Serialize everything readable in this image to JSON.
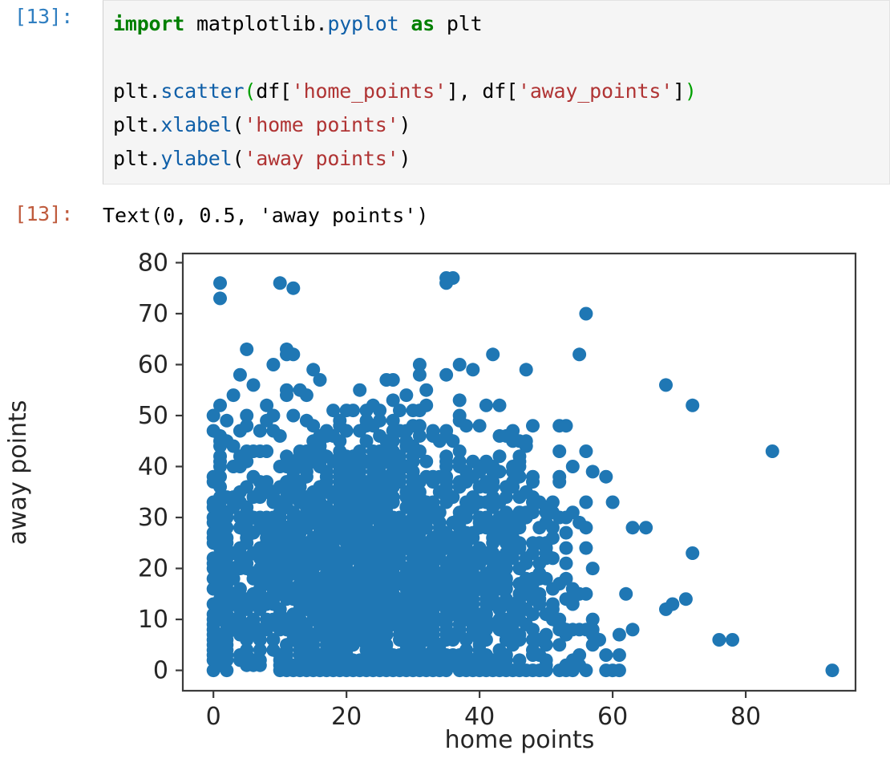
{
  "cell": {
    "input_prompt": "[13]:",
    "output_prompt": "[13]:",
    "code_lines": [
      "import matplotlib.pyplot as plt",
      "",
      "plt.scatter(df['home_points'], df['away_points'])",
      "plt.xlabel('home points')",
      "plt.ylabel('away points')"
    ],
    "code_tokens": {
      "l1_kw": "import",
      "l1_sp1": " ",
      "l1_mod_a": "matplotlib.",
      "l1_mod_b": "pyplot",
      "l1_sp2": " ",
      "l1_as": "as",
      "l1_sp3": " ",
      "l1_plt": "plt",
      "l3_plt": "plt.",
      "l3_fn": "scatter",
      "l3_open": "(",
      "l3_df1": "df[",
      "l3_s1": "'home_points'",
      "l3_mid": "], df[",
      "l3_s2": "'away_points'",
      "l3_close1": "]",
      "l3_close2": ")",
      "l4_plt": "plt.",
      "l4_fn": "xlabel",
      "l4_open": "(",
      "l4_s": "'home points'",
      "l4_close": ")",
      "l5_plt": "plt.",
      "l5_fn": "ylabel",
      "l5_open": "(",
      "l5_s": "'away points'",
      "l5_close": ")"
    },
    "output_text": "Text(0, 0.5, 'away points')"
  },
  "colors": {
    "input_prompt": "#307fc1",
    "output_prompt": "#bf5b3d",
    "cell_background": "#f5f5f5",
    "cell_border": "#e3e3e3",
    "marker": "#1f77b4",
    "axis": "#3b3b3b",
    "keyword": "#007f00",
    "function": "#0f5fa8",
    "string": "#b03434",
    "paren": "#00a000"
  },
  "chart_data": {
    "type": "scatter",
    "title": "",
    "xlabel": "home points",
    "ylabel": "away points",
    "xlim": [
      -4.6,
      96.5
    ],
    "ylim": [
      -4.0,
      81.8
    ],
    "xticks": [
      0,
      20,
      40,
      60,
      80
    ],
    "yticks": [
      0,
      10,
      20,
      30,
      40,
      50,
      60,
      70,
      80
    ],
    "xtick_labels": [
      "0",
      "20",
      "40",
      "60",
      "80"
    ],
    "ytick_labels": [
      "0",
      "10",
      "20",
      "30",
      "40",
      "50",
      "60",
      "70",
      "80"
    ],
    "grid": false,
    "legend": null,
    "marker_color": "#1f77b4",
    "marker_size": 17,
    "n_points": 2600,
    "description": "Dense scatter of home_points vs away_points. Bulk of mass between 0-60 on both axes with heavy saturation 5-50 home and 0-45 away. Strong pile-up along away=0 baseline across home 0-78. Sparse tail to the right. Notable outliers at approximately (84,43) and (93,0).",
    "notable_points": [
      [
        84,
        43
      ],
      [
        93,
        0
      ],
      [
        56,
        70
      ],
      [
        1,
        76
      ],
      [
        1,
        73
      ],
      [
        10,
        76
      ],
      [
        12,
        75
      ],
      [
        35,
        77
      ],
      [
        36,
        77
      ],
      [
        35,
        76
      ],
      [
        55,
        62
      ],
      [
        68,
        56
      ],
      [
        72,
        52
      ],
      [
        78,
        6
      ],
      [
        76,
        6
      ]
    ],
    "distribution_hint": {
      "x_mode": 27,
      "x_sd": 14,
      "y_mode": 24,
      "y_sd": 14,
      "baseline_fraction": 0.11,
      "x_max": 93,
      "y_max": 77
    }
  }
}
